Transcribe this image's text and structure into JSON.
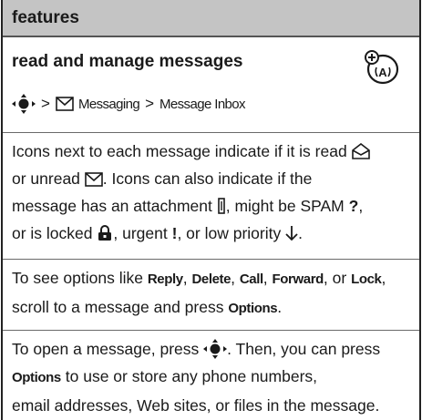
{
  "header": {
    "title": "features"
  },
  "section": {
    "title": "read and manage messages",
    "badge_icon": "network-service-icon",
    "path": {
      "separator": ">",
      "menu": "Messaging",
      "item": "Message Inbox"
    }
  },
  "para1": {
    "t1": "Icons next to each message indicate if it is read",
    "t2": "or unread",
    "t3": ". Icons can also indicate if the",
    "t4": "message has an attachment",
    "t5": ", might be SPAM",
    "spam_mark": "?",
    "t6": ",",
    "t7": "or is locked",
    "t8": ", urgent",
    "urgent_mark": "!",
    "t9": ", or low priority",
    "t10": "."
  },
  "para2": {
    "t1": "To see options like",
    "reply": "Reply",
    "c1": ",",
    "delete": "Delete",
    "c2": ",",
    "call": "Call",
    "c3": ",",
    "forward": "Forward",
    "c4": ", or",
    "lock": "Lock",
    "c5": ",",
    "t2": "scroll to a message and press",
    "options": "Options",
    "end": "."
  },
  "para3": {
    "t1": "To open a message, press",
    "t2": ". Then, you can press",
    "options": "Options",
    "t3": "to use or store any phone numbers,",
    "t4": "email addresses, Web sites, or files in the message."
  }
}
